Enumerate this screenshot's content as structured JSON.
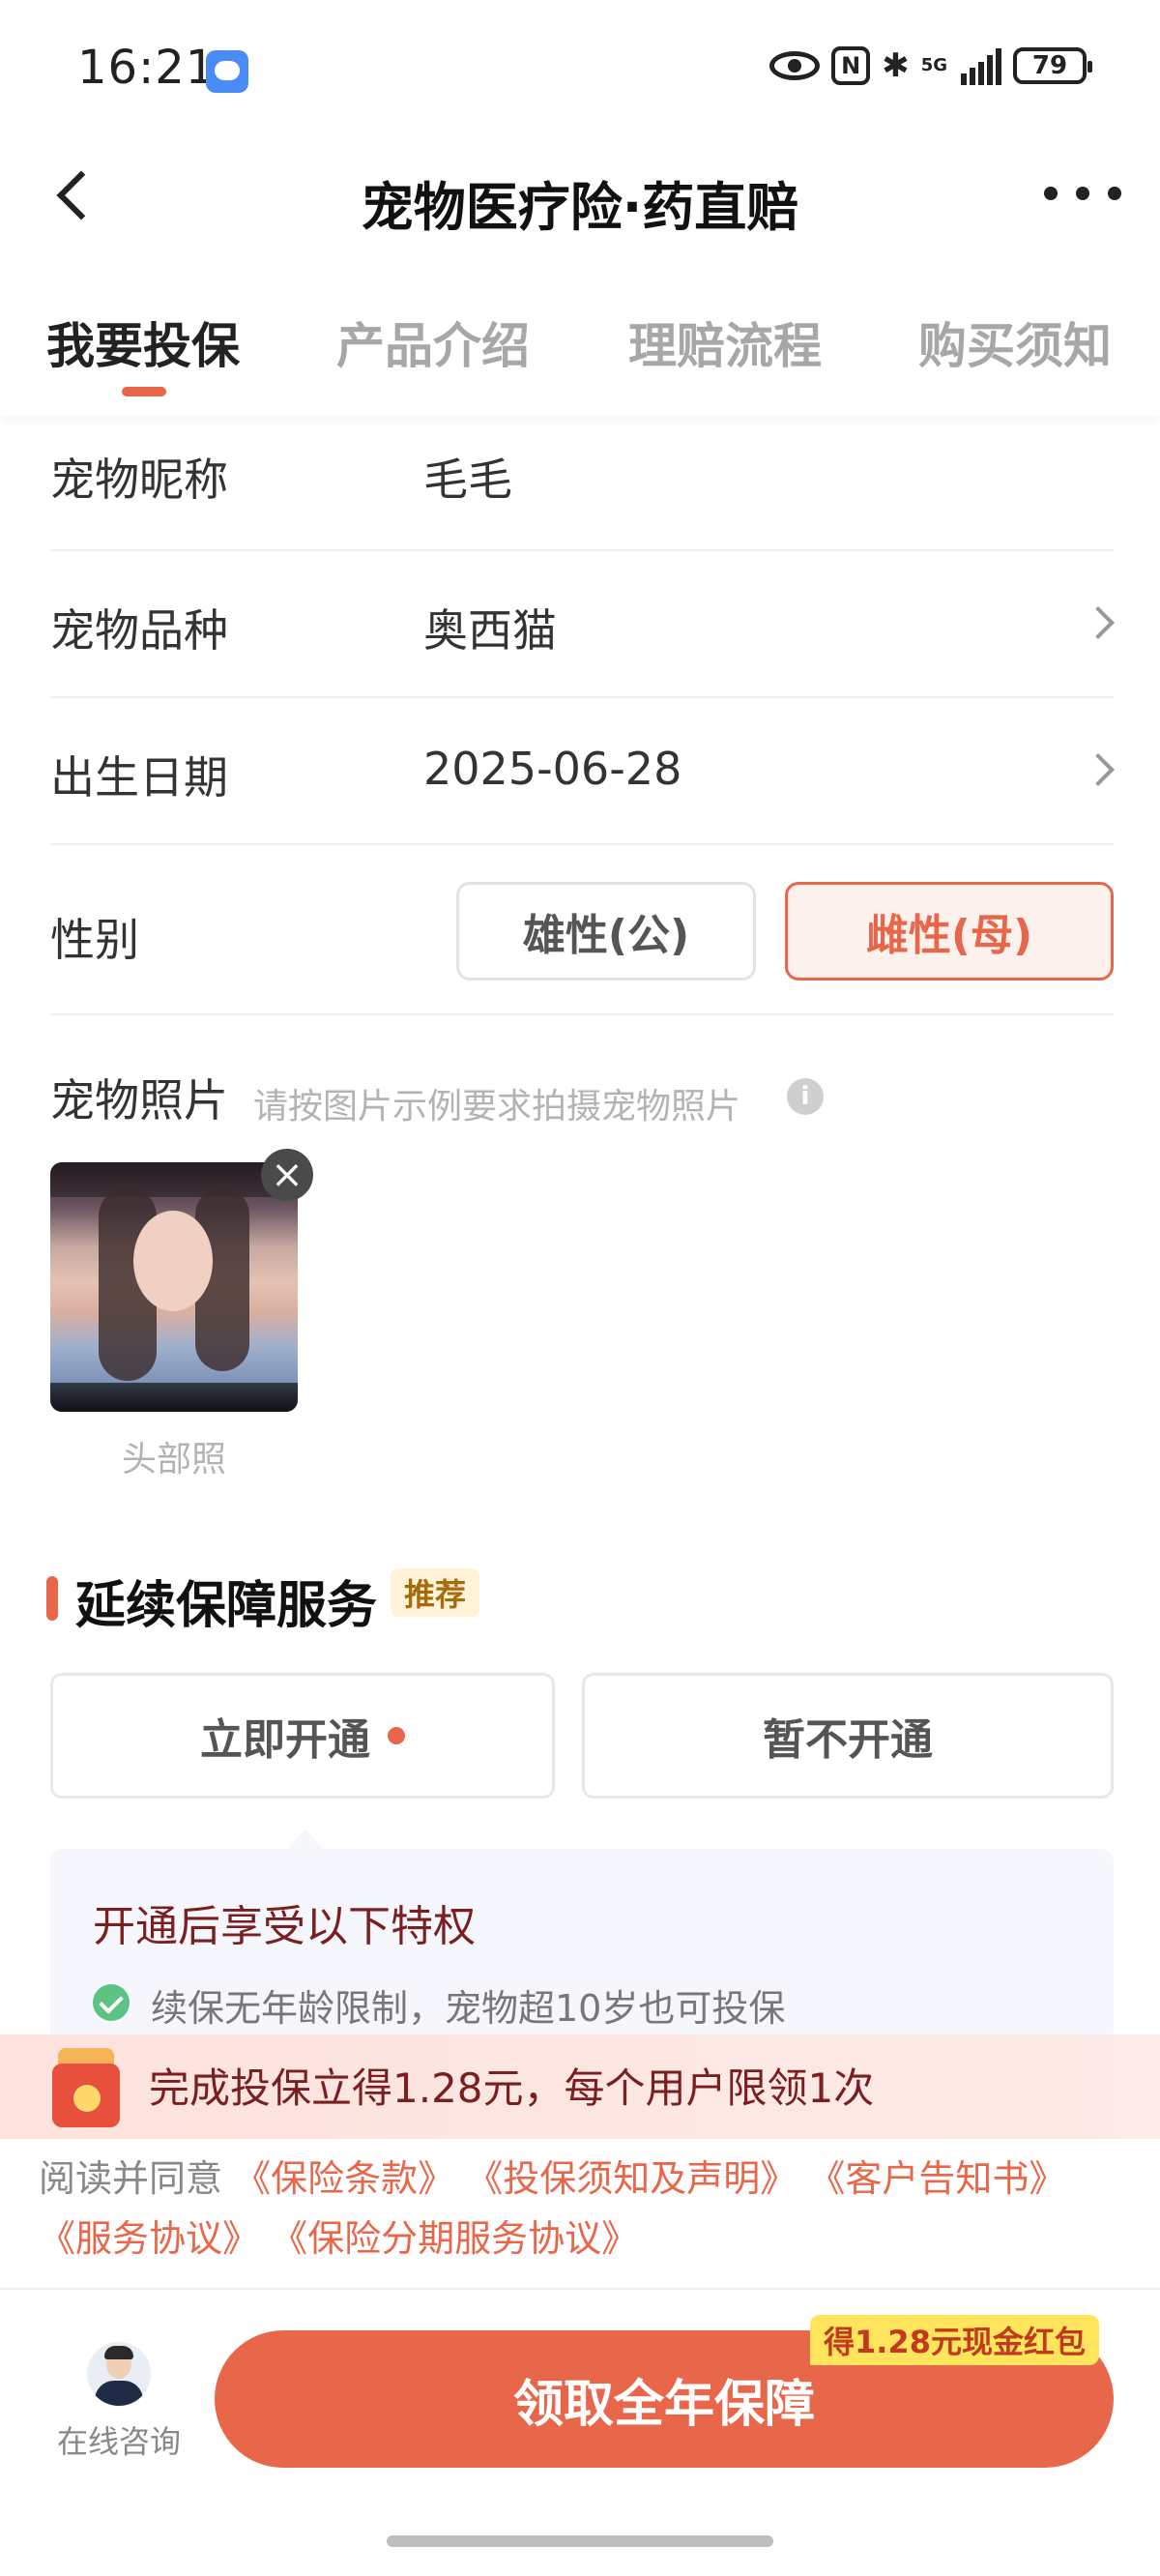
{
  "status_bar": {
    "time": "16:21",
    "network": "5G",
    "battery": "79"
  },
  "header": {
    "title": "宠物医疗险·药直赔"
  },
  "tabs": [
    {
      "label": "我要投保",
      "active": true
    },
    {
      "label": "产品介绍",
      "active": false
    },
    {
      "label": "理赔流程",
      "active": false
    },
    {
      "label": "购买须知",
      "active": false
    }
  ],
  "form": {
    "nickname": {
      "label": "宠物昵称",
      "value": "毛毛"
    },
    "breed": {
      "label": "宠物品种",
      "value": "奥西猫"
    },
    "birthday": {
      "label": "出生日期",
      "value": "2025-06-28"
    },
    "gender": {
      "label": "性别",
      "options": [
        "雄性(公)",
        "雌性(母)"
      ],
      "selected": "雌性(母)"
    },
    "photo": {
      "label": "宠物照片",
      "hint": "请按图片示例要求拍摄宠物照片",
      "caption": "头部照"
    }
  },
  "renewal": {
    "title": "延续保障服务",
    "badge": "推荐",
    "enable_label": "立即开通",
    "disable_label": "暂不开通",
    "benefits_title": "开通后享受以下特权",
    "benefit_1": "续保无年龄限制，宠物超10岁也可投保"
  },
  "reward_banner": {
    "text": "完成投保立得1.28元，每个用户限领1次"
  },
  "agreement": {
    "prefix": "阅读并同意",
    "links": [
      "《保险条款》",
      "《投保须知及声明》",
      "《客户告知书》",
      "《服务协议》",
      "《保险分期服务协议》"
    ]
  },
  "bottom_bar": {
    "consult_label": "在线咨询",
    "cta_label": "领取全年保障",
    "cta_badge": "得1.28元现金红包"
  },
  "colors": {
    "accent": "#e8674a",
    "benefit_text": "#7a1f1f",
    "check": "#5cc383"
  }
}
